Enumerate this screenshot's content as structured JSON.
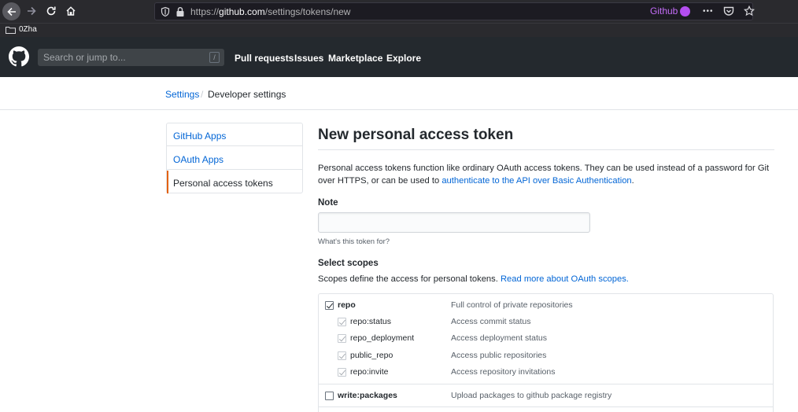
{
  "browser": {
    "url_prefix": "https://",
    "url_domain": "github.com",
    "url_path": "/settings/tokens/new",
    "container_label": "Github",
    "container_color": "#b44ef0",
    "more_icon": "•••",
    "bookmark_folder": "0Zha"
  },
  "gh_header": {
    "search_placeholder": "Search or jump to...",
    "search_shortcut": "/",
    "nav": [
      "Pull requests",
      "Issues",
      "Marketplace",
      "Explore"
    ]
  },
  "breadcrumb": {
    "settings": "Settings",
    "separator": "/",
    "current": "Developer settings"
  },
  "sidebar": {
    "items": [
      {
        "label": "GitHub Apps",
        "active": false
      },
      {
        "label": "OAuth Apps",
        "active": false
      },
      {
        "label": "Personal access tokens",
        "active": true
      }
    ]
  },
  "main": {
    "title": "New personal access token",
    "intro_text": "Personal access tokens function like ordinary OAuth access tokens. They can be used instead of a password for Git over HTTPS, or can be used to ",
    "intro_link": "authenticate to the API over Basic Authentication",
    "intro_end": ".",
    "note_label": "Note",
    "note_value": "",
    "note_help": "What's this token for?",
    "scopes_label": "Select scopes",
    "scopes_desc": "Scopes define the access for personal tokens. ",
    "scopes_link": "Read more about OAuth scopes."
  },
  "scopes": [
    {
      "name": "repo",
      "desc": "Full control of private repositories",
      "checked": true,
      "parent": true,
      "children": [
        {
          "name": "repo:status",
          "desc": "Access commit status"
        },
        {
          "name": "repo_deployment",
          "desc": "Access deployment status"
        },
        {
          "name": "public_repo",
          "desc": "Access public repositories"
        },
        {
          "name": "repo:invite",
          "desc": "Access repository invitations"
        }
      ]
    },
    {
      "name": "write:packages",
      "desc": "Upload packages to github package registry",
      "checked": false,
      "parent": true,
      "children": []
    }
  ],
  "colors": {
    "header_bg": "#24292e",
    "link": "#0366d6",
    "active_accent": "#e36209"
  }
}
